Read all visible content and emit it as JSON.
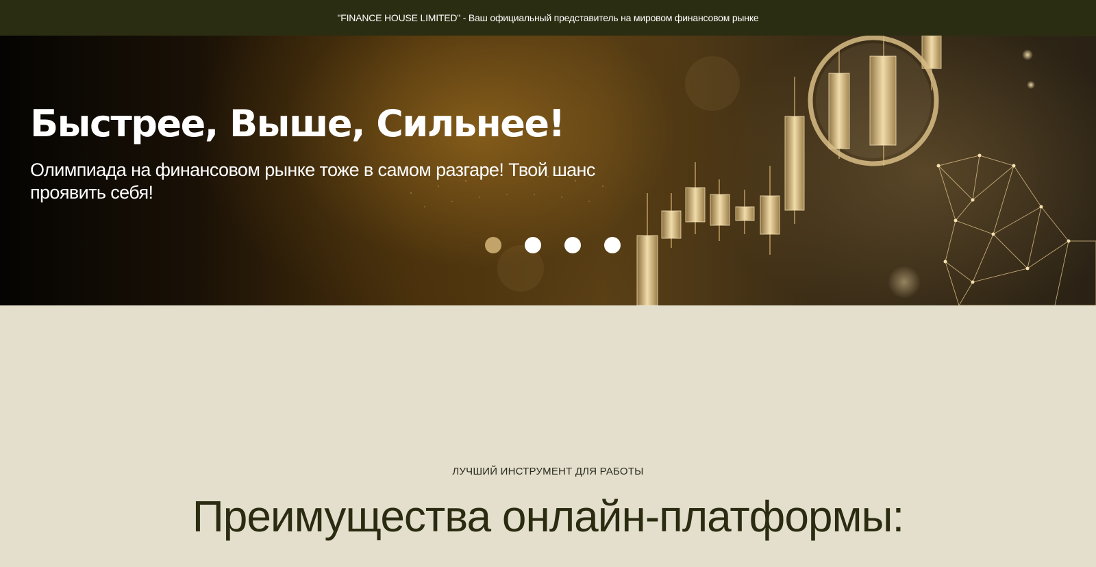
{
  "topbar": {
    "text": "\"FINANCE HOUSE LIMITED\" - Ваш официальный представитель на мировом финансовом рынке"
  },
  "hero": {
    "title": "Быстрее, Выше, Сильнее!",
    "subtitle": "Олимпиада на финансовом рынке тоже в самом разгаре! Твой шанс проявить себя!",
    "image_icon": "candlestick-magnifier-art",
    "slider": {
      "total_slides": 4,
      "active_index": 1,
      "active_color": "#c2a46a",
      "inactive_color": "#ffffff"
    }
  },
  "section": {
    "eyebrow": "ЛУЧШИЙ ИНСТРУМЕНТ ДЛЯ РАБОТЫ",
    "title": "Преимущества онлайн-платформы:"
  },
  "colors": {
    "topbar_bg": "#2b2d12",
    "page_bg": "#e3dfcc",
    "heading": "#2a2b10",
    "accent_gold": "#c2a46a"
  }
}
